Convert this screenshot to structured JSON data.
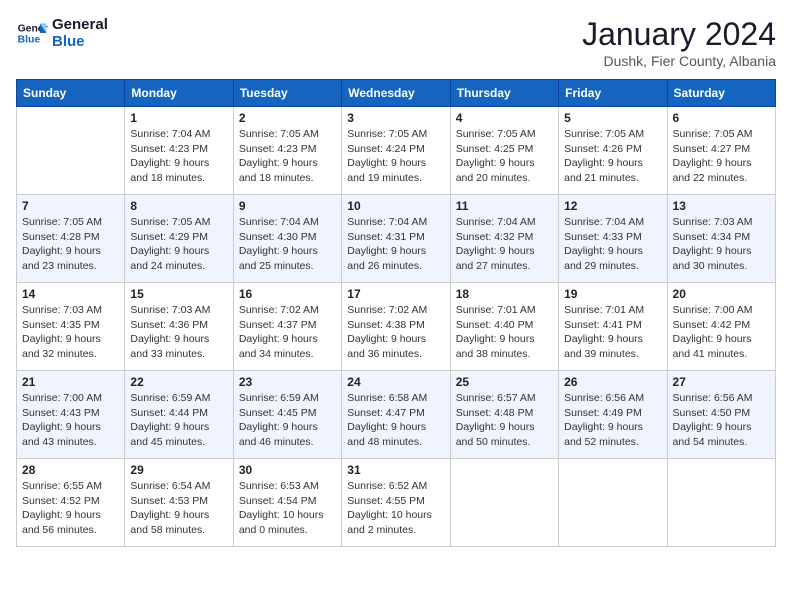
{
  "logo": {
    "text_general": "General",
    "text_blue": "Blue"
  },
  "title": "January 2024",
  "subtitle": "Dushk, Fier County, Albania",
  "weekdays": [
    "Sunday",
    "Monday",
    "Tuesday",
    "Wednesday",
    "Thursday",
    "Friday",
    "Saturday"
  ],
  "weeks": [
    [
      {
        "day": null,
        "info": null
      },
      {
        "day": "1",
        "info": "Sunrise: 7:04 AM\nSunset: 4:23 PM\nDaylight: 9 hours\nand 18 minutes."
      },
      {
        "day": "2",
        "info": "Sunrise: 7:05 AM\nSunset: 4:23 PM\nDaylight: 9 hours\nand 18 minutes."
      },
      {
        "day": "3",
        "info": "Sunrise: 7:05 AM\nSunset: 4:24 PM\nDaylight: 9 hours\nand 19 minutes."
      },
      {
        "day": "4",
        "info": "Sunrise: 7:05 AM\nSunset: 4:25 PM\nDaylight: 9 hours\nand 20 minutes."
      },
      {
        "day": "5",
        "info": "Sunrise: 7:05 AM\nSunset: 4:26 PM\nDaylight: 9 hours\nand 21 minutes."
      },
      {
        "day": "6",
        "info": "Sunrise: 7:05 AM\nSunset: 4:27 PM\nDaylight: 9 hours\nand 22 minutes."
      }
    ],
    [
      {
        "day": "7",
        "info": "Sunrise: 7:05 AM\nSunset: 4:28 PM\nDaylight: 9 hours\nand 23 minutes."
      },
      {
        "day": "8",
        "info": "Sunrise: 7:05 AM\nSunset: 4:29 PM\nDaylight: 9 hours\nand 24 minutes."
      },
      {
        "day": "9",
        "info": "Sunrise: 7:04 AM\nSunset: 4:30 PM\nDaylight: 9 hours\nand 25 minutes."
      },
      {
        "day": "10",
        "info": "Sunrise: 7:04 AM\nSunset: 4:31 PM\nDaylight: 9 hours\nand 26 minutes."
      },
      {
        "day": "11",
        "info": "Sunrise: 7:04 AM\nSunset: 4:32 PM\nDaylight: 9 hours\nand 27 minutes."
      },
      {
        "day": "12",
        "info": "Sunrise: 7:04 AM\nSunset: 4:33 PM\nDaylight: 9 hours\nand 29 minutes."
      },
      {
        "day": "13",
        "info": "Sunrise: 7:03 AM\nSunset: 4:34 PM\nDaylight: 9 hours\nand 30 minutes."
      }
    ],
    [
      {
        "day": "14",
        "info": "Sunrise: 7:03 AM\nSunset: 4:35 PM\nDaylight: 9 hours\nand 32 minutes."
      },
      {
        "day": "15",
        "info": "Sunrise: 7:03 AM\nSunset: 4:36 PM\nDaylight: 9 hours\nand 33 minutes."
      },
      {
        "day": "16",
        "info": "Sunrise: 7:02 AM\nSunset: 4:37 PM\nDaylight: 9 hours\nand 34 minutes."
      },
      {
        "day": "17",
        "info": "Sunrise: 7:02 AM\nSunset: 4:38 PM\nDaylight: 9 hours\nand 36 minutes."
      },
      {
        "day": "18",
        "info": "Sunrise: 7:01 AM\nSunset: 4:40 PM\nDaylight: 9 hours\nand 38 minutes."
      },
      {
        "day": "19",
        "info": "Sunrise: 7:01 AM\nSunset: 4:41 PM\nDaylight: 9 hours\nand 39 minutes."
      },
      {
        "day": "20",
        "info": "Sunrise: 7:00 AM\nSunset: 4:42 PM\nDaylight: 9 hours\nand 41 minutes."
      }
    ],
    [
      {
        "day": "21",
        "info": "Sunrise: 7:00 AM\nSunset: 4:43 PM\nDaylight: 9 hours\nand 43 minutes."
      },
      {
        "day": "22",
        "info": "Sunrise: 6:59 AM\nSunset: 4:44 PM\nDaylight: 9 hours\nand 45 minutes."
      },
      {
        "day": "23",
        "info": "Sunrise: 6:59 AM\nSunset: 4:45 PM\nDaylight: 9 hours\nand 46 minutes."
      },
      {
        "day": "24",
        "info": "Sunrise: 6:58 AM\nSunset: 4:47 PM\nDaylight: 9 hours\nand 48 minutes."
      },
      {
        "day": "25",
        "info": "Sunrise: 6:57 AM\nSunset: 4:48 PM\nDaylight: 9 hours\nand 50 minutes."
      },
      {
        "day": "26",
        "info": "Sunrise: 6:56 AM\nSunset: 4:49 PM\nDaylight: 9 hours\nand 52 minutes."
      },
      {
        "day": "27",
        "info": "Sunrise: 6:56 AM\nSunset: 4:50 PM\nDaylight: 9 hours\nand 54 minutes."
      }
    ],
    [
      {
        "day": "28",
        "info": "Sunrise: 6:55 AM\nSunset: 4:52 PM\nDaylight: 9 hours\nand 56 minutes."
      },
      {
        "day": "29",
        "info": "Sunrise: 6:54 AM\nSunset: 4:53 PM\nDaylight: 9 hours\nand 58 minutes."
      },
      {
        "day": "30",
        "info": "Sunrise: 6:53 AM\nSunset: 4:54 PM\nDaylight: 10 hours\nand 0 minutes."
      },
      {
        "day": "31",
        "info": "Sunrise: 6:52 AM\nSunset: 4:55 PM\nDaylight: 10 hours\nand 2 minutes."
      },
      {
        "day": null,
        "info": null
      },
      {
        "day": null,
        "info": null
      },
      {
        "day": null,
        "info": null
      }
    ]
  ]
}
